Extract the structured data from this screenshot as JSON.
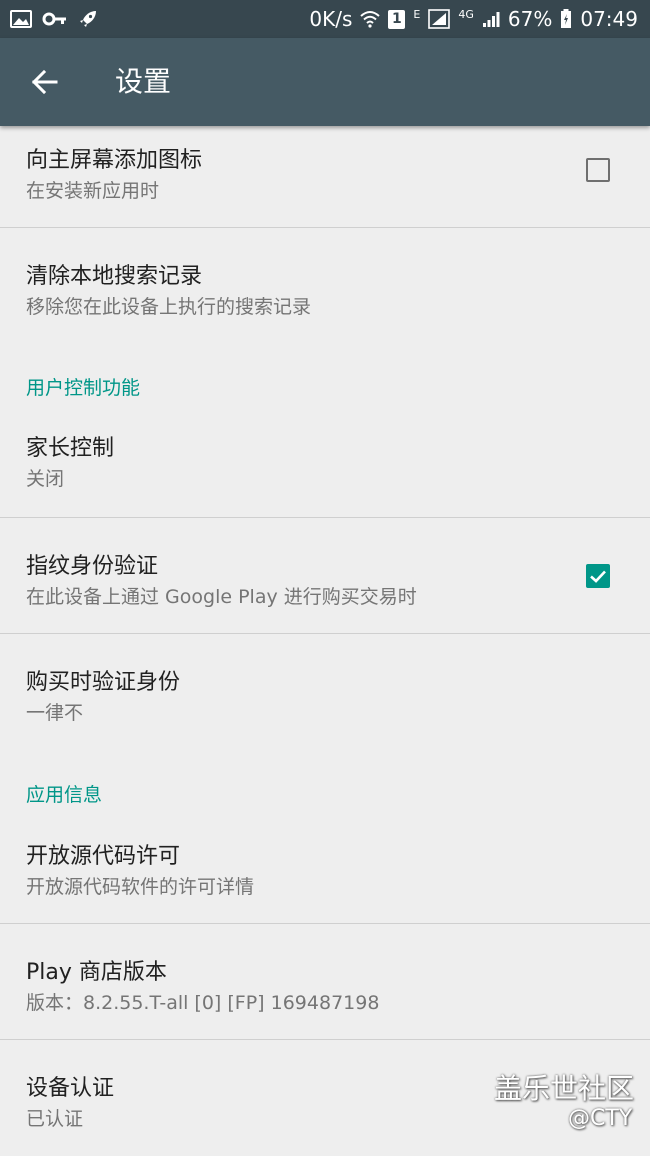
{
  "status_bar": {
    "speed": "0K/s",
    "sim_badge": "1",
    "network_e": "E",
    "network_4g": "4G",
    "battery": "67%",
    "time": "07:49"
  },
  "app_bar": {
    "title": "设置"
  },
  "items": [
    {
      "title": "向主屏幕添加图标",
      "subtitle": "在安装新应用时",
      "checked": false
    },
    {
      "title": "清除本地搜索记录",
      "subtitle": "移除您在此设备上执行的搜索记录"
    },
    {
      "title": "家长控制",
      "subtitle": "关闭"
    },
    {
      "title": "指纹身份验证",
      "subtitle": "在此设备上通过 Google Play 进行购买交易时",
      "checked": true
    },
    {
      "title": "购买时验证身份",
      "subtitle": "一律不"
    },
    {
      "title": "开放源代码许可",
      "subtitle": "开放源代码软件的许可详情"
    },
    {
      "title": "Play 商店版本",
      "subtitle": "版本：8.2.55.T-all [0] [FP] 169487198"
    },
    {
      "title": "设备认证",
      "subtitle": "已认证"
    }
  ],
  "sections": {
    "user_controls": "用户控制功能",
    "app_info": "应用信息"
  },
  "watermark": {
    "brand": "盖乐世社区",
    "user": "@CTY"
  },
  "colors": {
    "accent": "#009688",
    "app_bar": "#455a64",
    "status_bar": "#37474f"
  }
}
